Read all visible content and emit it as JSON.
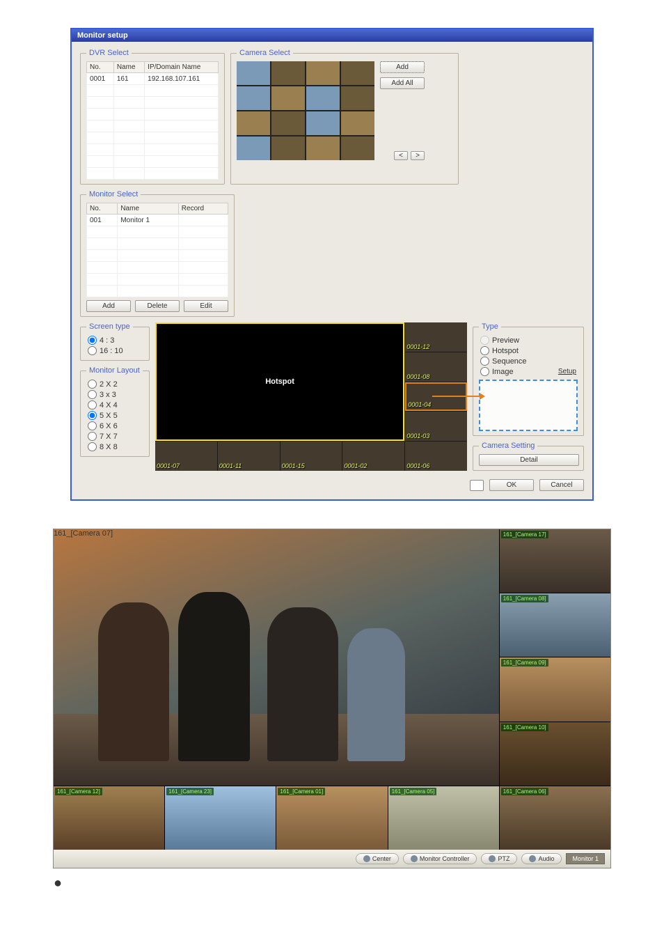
{
  "window": {
    "title": "Monitor setup"
  },
  "dvr": {
    "legend": "DVR Select",
    "cols": [
      "No.",
      "Name",
      "IP/Domain Name"
    ],
    "rows": [
      [
        "0001",
        "161",
        "192.168.107.161"
      ]
    ]
  },
  "cam": {
    "legend": "Camera Select",
    "add": "Add",
    "addAll": "Add All",
    "prev": "<",
    "next": ">"
  },
  "mon": {
    "legend": "Monitor Select",
    "cols": [
      "No.",
      "Name",
      "Record"
    ],
    "rows": [
      [
        "001",
        "Monitor 1",
        ""
      ]
    ],
    "add": "Add",
    "del": "Delete",
    "edit": "Edit"
  },
  "screen": {
    "legend": "Screen type",
    "opts": [
      "4 : 3",
      "16 : 10"
    ],
    "selected": 0
  },
  "layout": {
    "legend": "Monitor Layout",
    "opts": [
      "2 X 2",
      "3 x 3",
      "4 X 4",
      "5 X 5",
      "6 X 6",
      "7 X 7",
      "8 X 8"
    ],
    "selected": 3
  },
  "preview": {
    "hotspot": "Hotspot",
    "cells": [
      "0001-12",
      "0001-08",
      "0001-04",
      "0001-03",
      "0001-07",
      "0001-11",
      "0001-15",
      "0001-02",
      "0001-06"
    ]
  },
  "type": {
    "legend": "Type",
    "opts": [
      "Preview",
      "Hotspot",
      "Sequence",
      "Image"
    ],
    "disabled": 0,
    "selected": -1,
    "setup": "Setup"
  },
  "camset": {
    "legend": "Camera Setting",
    "detail": "Detail"
  },
  "footer": {
    "ok": "OK",
    "cancel": "Cancel"
  },
  "app2": {
    "mainTag": "161_[Camera 07]",
    "side": [
      "161_[Camera 17]",
      "161_[Camera 08]",
      "161_[Camera 09]",
      "161_[Camera 10]"
    ],
    "bottom": [
      "161_[Camera 12]",
      "161_[Camera 23]",
      "161_[Camera 01]",
      "161_[Camera 05]",
      "161_[Camera 06]"
    ],
    "tb": {
      "center": "Center",
      "mc": "Monitor Controller",
      "ptz": "PTZ",
      "audio": "Audio",
      "mon": "Monitor 1"
    }
  }
}
